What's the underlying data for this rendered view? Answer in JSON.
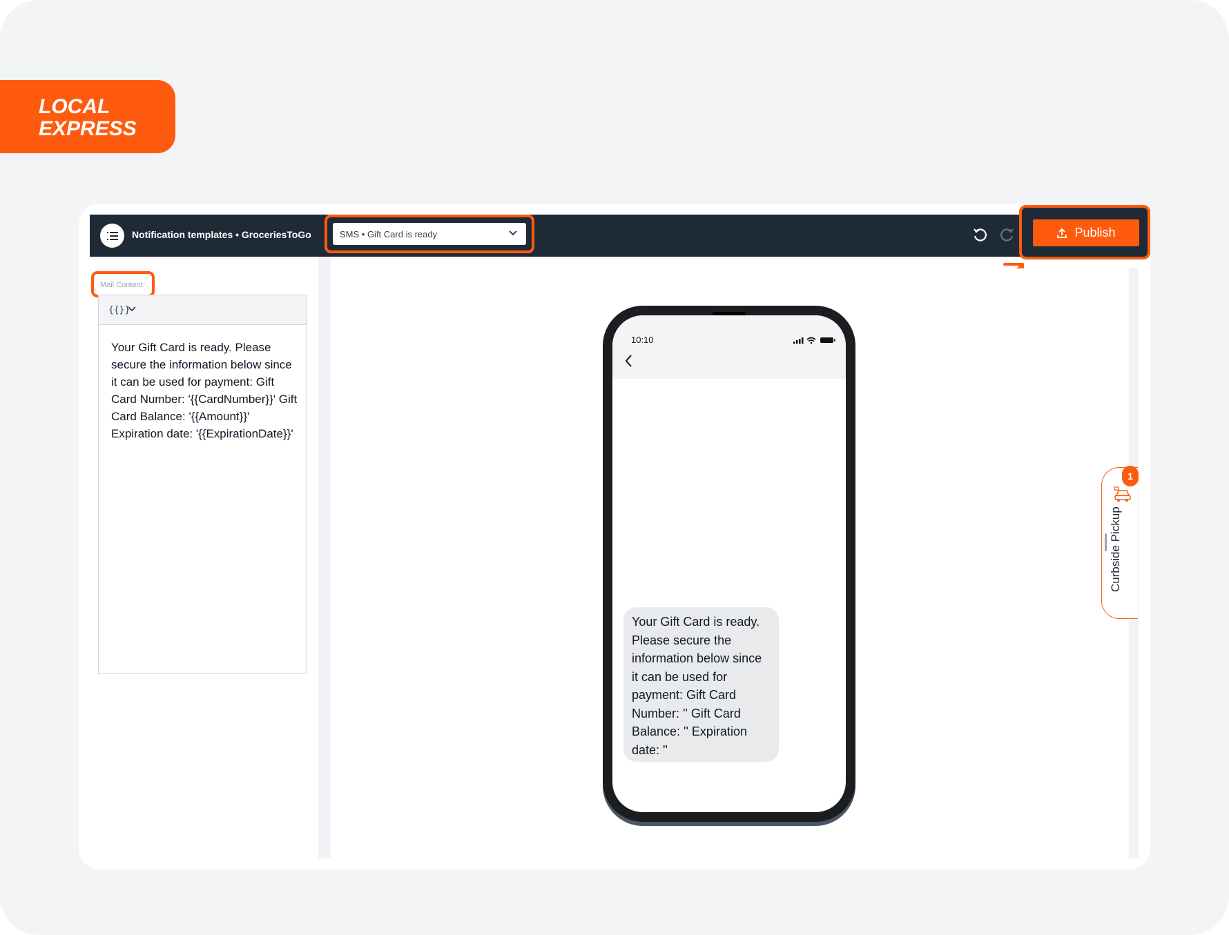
{
  "brand": {
    "line1": "LOCAL",
    "line2": "EXPRESS",
    "color": "#ff5b0f"
  },
  "topbar": {
    "title": "Notification templates • GroceriesToGo",
    "template_select": {
      "value": "SMS • Gift Card is ready"
    },
    "publish_label": "Publish"
  },
  "editor": {
    "section_label": "Mail Content",
    "vars_label": "{{}}",
    "content": "Your Gift Card is ready. Please secure the information below since it can be used for payment: Gift Card Number: '{{CardNumber}}' Gift Card Balance: '{{Amount}}' Expiration date: '{{ExpirationDate}}'"
  },
  "phone": {
    "time": "10:10",
    "message": "Your Gift Card is ready. Please secure the information below since it can be used for payment: Gift Card Number: '' Gift Card Balance: '' Expiration date: ''"
  },
  "curbside": {
    "label": "Curbside Pickup",
    "badge": "1"
  },
  "colors": {
    "accent": "#ff5b0f",
    "topbar": "#1f2a37",
    "bubble": "#e9eaeb"
  }
}
